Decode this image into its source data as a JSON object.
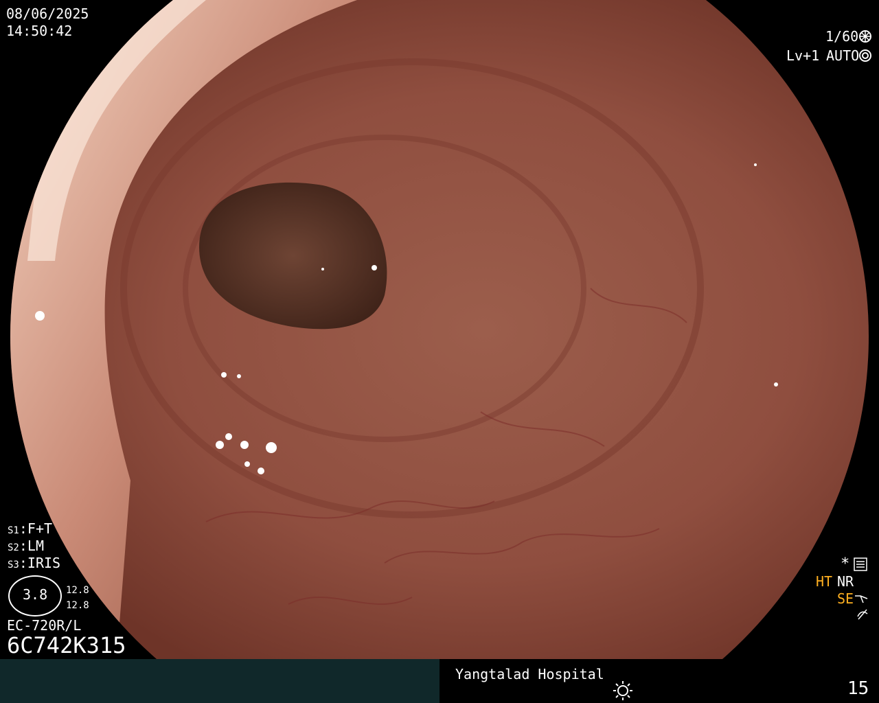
{
  "datetime": {
    "date": "08/06/2025",
    "time": "14:50:42"
  },
  "camera": {
    "shutter": "1/60",
    "level": "Lv+1",
    "mode": "AUTO"
  },
  "settings": {
    "s1": {
      "key": "S1",
      "value": "F+T"
    },
    "s2": {
      "key": "S2",
      "value": "LM"
    },
    "s3": {
      "key": "S3",
      "value": "IRIS"
    }
  },
  "gauge": {
    "value": "3.8",
    "upper": "12.8",
    "lower": "12.8"
  },
  "scope_model": "EC-720R/L",
  "serial": "6C742K315",
  "modes": {
    "ht": "HT",
    "nr": "NR",
    "se": "SE"
  },
  "footer": {
    "hospital": "Yangtalad Hospital",
    "page": "15"
  },
  "icons": [
    "shutter-icon",
    "auto-iris-icon",
    "star-settings-icon",
    "structure-enhance-icon",
    "filter-icon",
    "sun-brightness-icon"
  ]
}
